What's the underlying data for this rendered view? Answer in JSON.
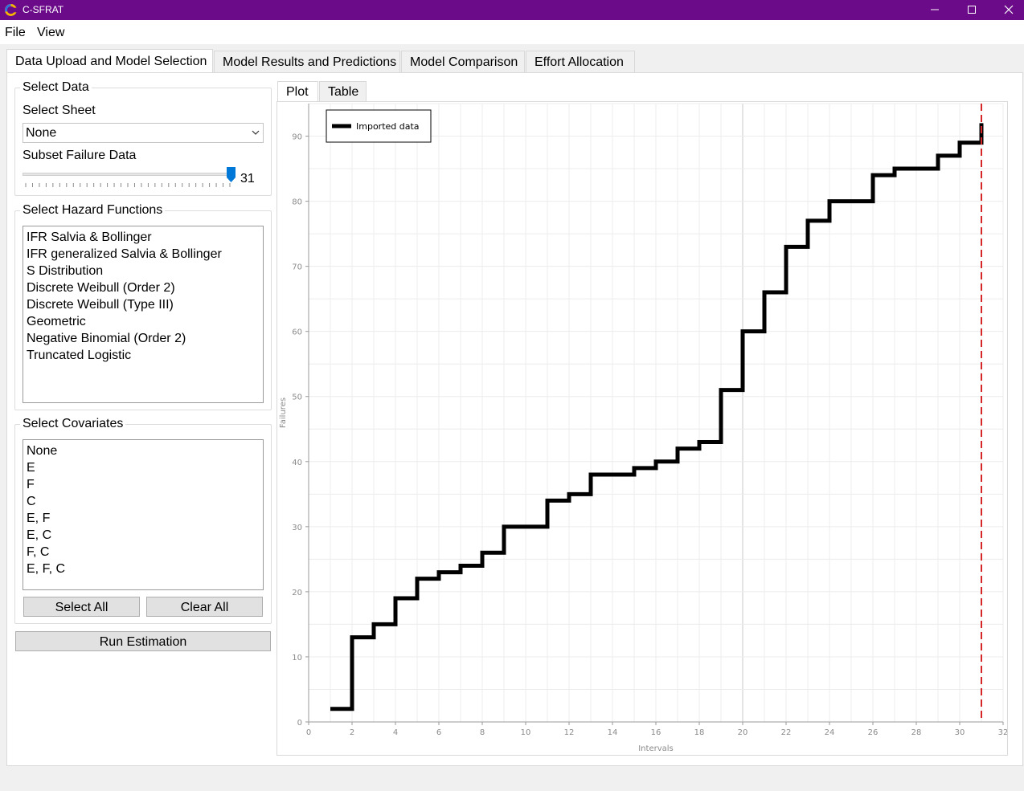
{
  "window": {
    "title": "C-SFRAT"
  },
  "menu": {
    "file": "File",
    "view": "View"
  },
  "tabs": [
    {
      "label": "Data Upload and Model Selection"
    },
    {
      "label": "Model Results and Predictions"
    },
    {
      "label": "Model Comparison"
    },
    {
      "label": "Effort Allocation"
    }
  ],
  "select_data": {
    "title": "Select Data",
    "sheet_label": "Select Sheet",
    "sheet_value": "None",
    "subset_label": "Subset Failure Data",
    "subset_value": "31",
    "subset_fraction": 1.0
  },
  "hazard": {
    "title": "Select Hazard Functions",
    "items": [
      "IFR Salvia & Bollinger",
      "IFR generalized Salvia & Bollinger",
      "S Distribution",
      "Discrete Weibull (Order 2)",
      "Discrete Weibull (Type III)",
      "Geometric",
      "Negative Binomial (Order 2)",
      "Truncated Logistic"
    ]
  },
  "covariates": {
    "title": "Select Covariates",
    "items": [
      "None",
      "E",
      "F",
      "C",
      "E, F",
      "E, C",
      "F, C",
      "E, F, C"
    ],
    "select_all": "Select All",
    "clear_all": "Clear All"
  },
  "run_button": "Run Estimation",
  "plot_tabs": {
    "plot": "Plot",
    "table": "Table"
  },
  "colors": {
    "titlebar": "#6b0b8a",
    "accent": "#0078d7",
    "line": "#000000",
    "marker": "#d62728"
  },
  "chart_data": {
    "type": "line",
    "step": true,
    "xlabel": "Intervals",
    "ylabel": "Failures",
    "xlim": [
      0,
      32
    ],
    "ylim": [
      0,
      95
    ],
    "xticks": [
      0,
      2,
      4,
      6,
      8,
      10,
      12,
      14,
      16,
      18,
      20,
      22,
      24,
      26,
      28,
      30,
      32
    ],
    "yticks": [
      0,
      10,
      20,
      30,
      40,
      50,
      60,
      70,
      80,
      90
    ],
    "legend": "top-left",
    "grid": true,
    "series": [
      {
        "name": "Imported data",
        "x": [
          1,
          2,
          3,
          4,
          5,
          6,
          7,
          8,
          9,
          10,
          11,
          12,
          13,
          14,
          15,
          16,
          17,
          18,
          19,
          20,
          21,
          22,
          23,
          24,
          25,
          26,
          27,
          28,
          29,
          30,
          31
        ],
        "y": [
          2,
          13,
          15,
          19,
          22,
          23,
          24,
          26,
          30,
          30,
          34,
          35,
          38,
          38,
          39,
          40,
          42,
          43,
          51,
          60,
          66,
          73,
          77,
          80,
          80,
          84,
          85,
          85,
          87,
          89,
          92
        ]
      }
    ],
    "vline_x": 31
  }
}
